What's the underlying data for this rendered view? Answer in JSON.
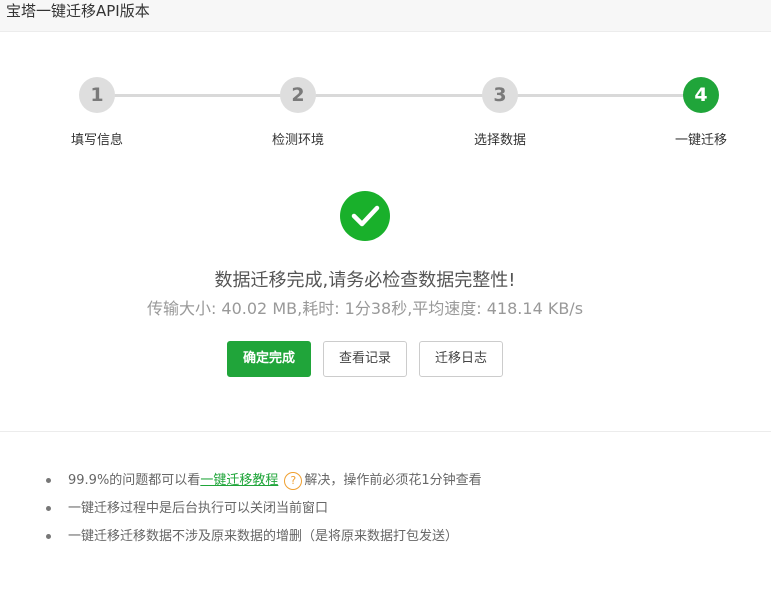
{
  "window": {
    "title": "宝塔一键迁移API版本"
  },
  "steps": [
    {
      "number": "1",
      "label": "填写信息"
    },
    {
      "number": "2",
      "label": "检测环境"
    },
    {
      "number": "3",
      "label": "选择数据"
    },
    {
      "number": "4",
      "label": "一键迁移"
    }
  ],
  "active_step": 4,
  "result": {
    "icon": "check-circle-icon",
    "title": "数据迁移完成,请务必检查数据完整性!",
    "stats": "传输大小: 40.02 MB,耗时: 1分38秒,平均速度: 418.14 KB/s"
  },
  "buttons": {
    "confirm": "确定完成",
    "view_records": "查看记录",
    "migration_log": "迁移日志"
  },
  "tips": {
    "tip1_prefix": "99.9%的问题都可以看",
    "tip1_link": "一键迁移教程",
    "tip1_help": "?",
    "tip1_suffix": "解决，操作前必须花1分钟查看",
    "tip2": "一键迁移过程中是后台执行可以关闭当前窗口",
    "tip3": "一键迁移迁移数据不涉及原来数据的增删（是将原来数据打包发送）"
  },
  "colors": {
    "accent": "#20a53a",
    "success": "#19b02b",
    "inactive_step": "#dedede",
    "help_icon": "#f0a030"
  }
}
